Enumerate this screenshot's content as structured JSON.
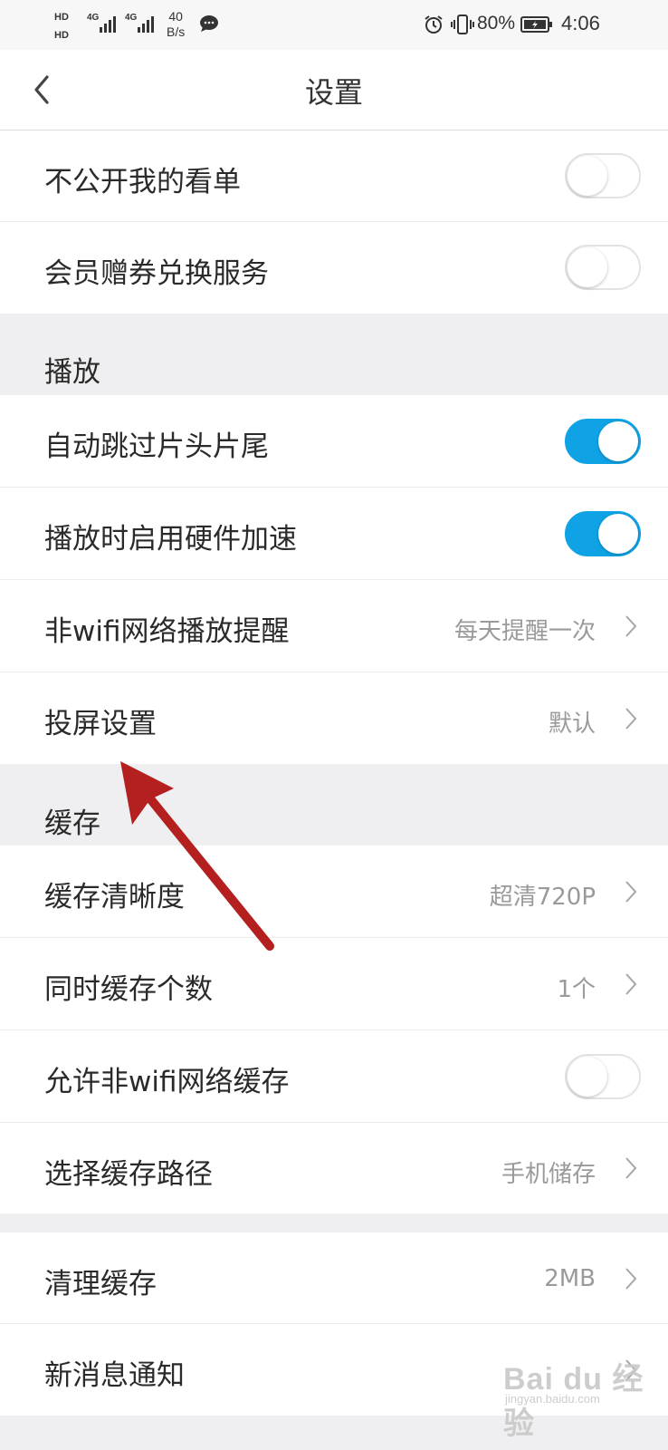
{
  "status_bar": {
    "hd1": "HD",
    "hd2": "HD",
    "net1": "4G",
    "net2": "4G",
    "speed_value": "40",
    "speed_unit": "B/s",
    "battery_percent": "80%",
    "time": "4:06",
    "icons": [
      "message-icon",
      "alarm-icon",
      "vibrate-icon",
      "battery-icon"
    ]
  },
  "header": {
    "title": "设置",
    "back_icon": "chevron-left-icon"
  },
  "rows": {
    "hide_watchlist": {
      "label": "不公开我的看单",
      "toggle": false
    },
    "vip_coupon": {
      "label": "会员赠券兑换服务",
      "toggle": false
    }
  },
  "sections": {
    "play": {
      "header": "播放",
      "auto_skip": {
        "label": "自动跳过片头片尾",
        "toggle": true
      },
      "hw_accel": {
        "label": "播放时启用硬件加速",
        "toggle": true
      },
      "non_wifi_remind": {
        "label": "非wifi网络播放提醒",
        "value": "每天提醒一次"
      },
      "cast": {
        "label": "投屏设置",
        "value": "默认"
      }
    },
    "cache": {
      "header": "缓存",
      "quality": {
        "label": "缓存清晰度",
        "value": "超清720P"
      },
      "concurrent": {
        "label": "同时缓存个数",
        "value": "1个"
      },
      "non_wifi_cache": {
        "label": "允许非wifi网络缓存",
        "toggle": false
      },
      "path": {
        "label": "选择缓存路径",
        "value": "手机储存"
      }
    },
    "misc": {
      "clear_cache": {
        "label": "清理缓存",
        "value": "2MB"
      },
      "notifications": {
        "label": "新消息通知"
      }
    }
  },
  "watermark": {
    "main": "Bai du 经验",
    "sub": "jingyan.baidu.com"
  },
  "colors": {
    "toggle_on": "#0fa3e6",
    "annotation_arrow": "#b3201f",
    "background": "#efeff1"
  }
}
